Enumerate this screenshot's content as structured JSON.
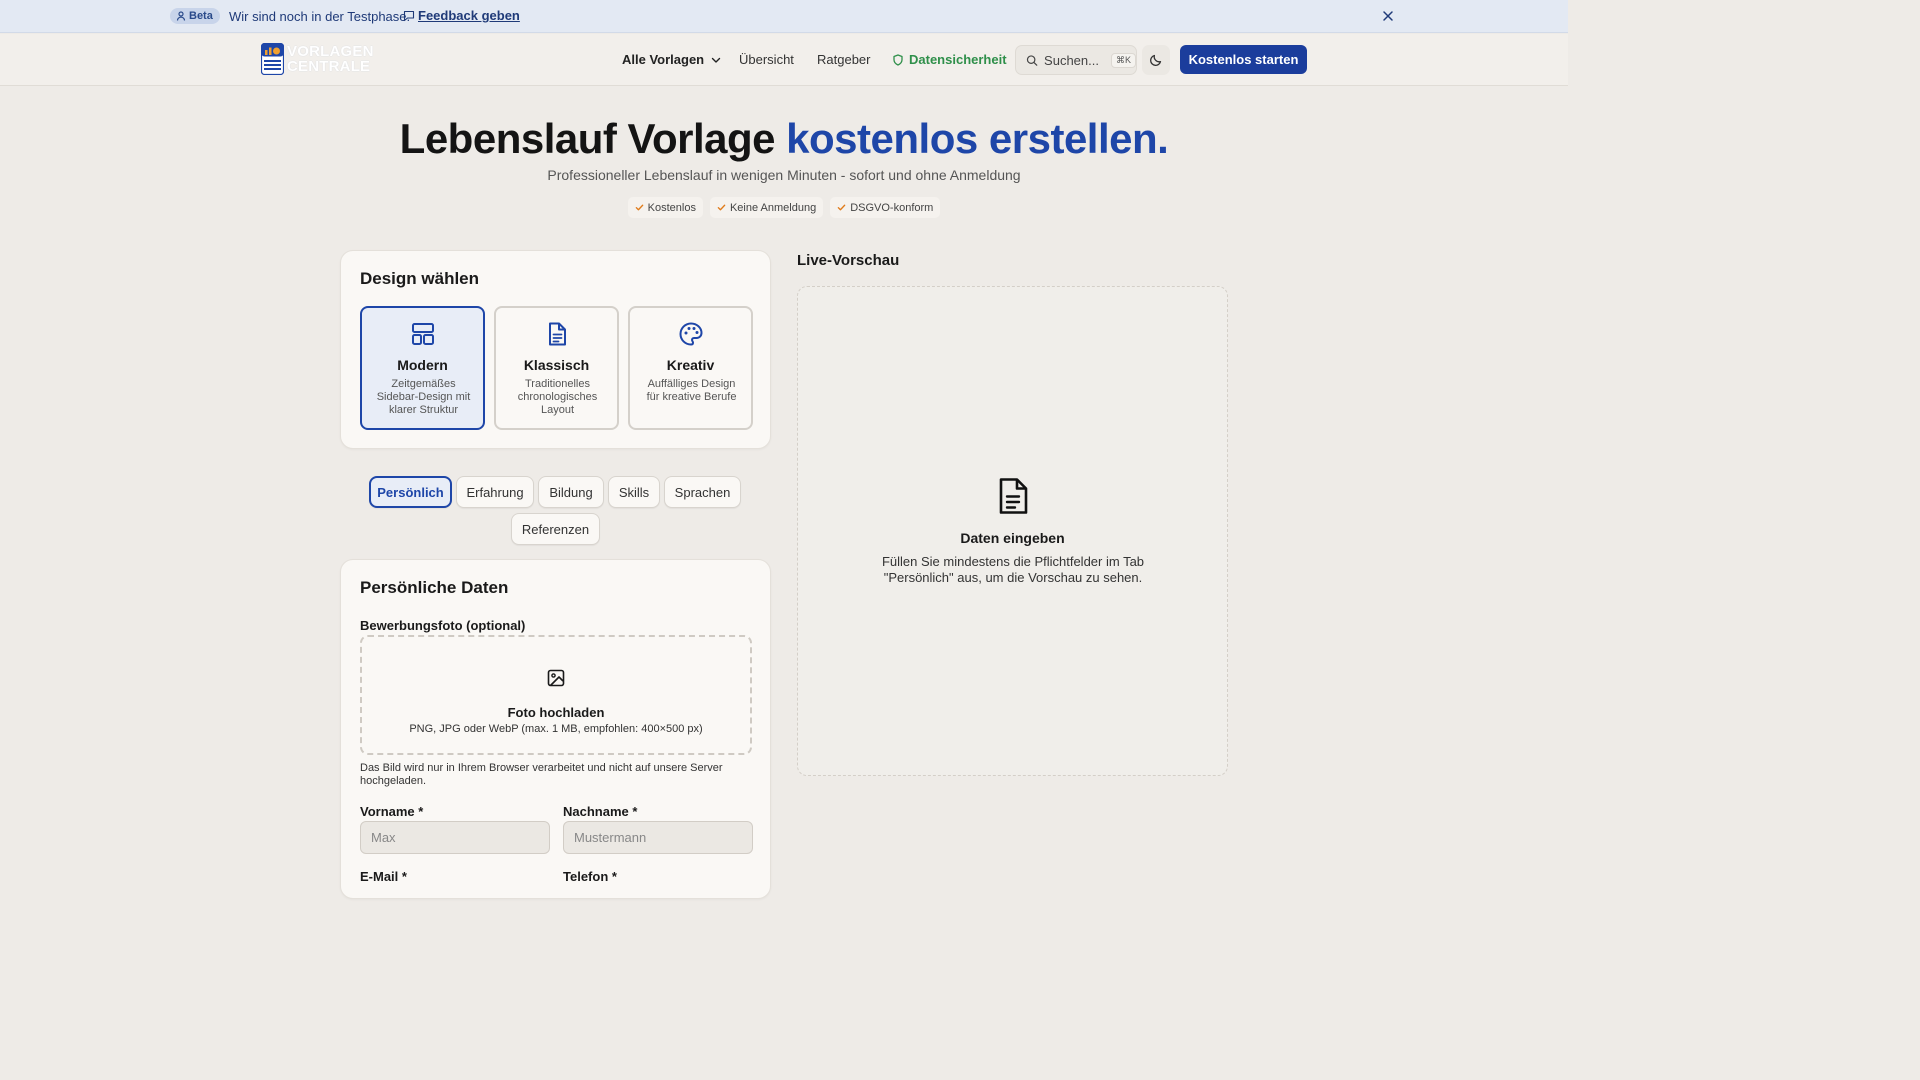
{
  "banner": {
    "badge": "Beta",
    "text": "Wir sind noch in der Testphase.",
    "feedback_link": "Feedback geben"
  },
  "header": {
    "logo_line1": "VORLAGEN",
    "logo_line2": "CENTRALE",
    "nav": {
      "all_templates": "Alle Vorlagen",
      "overview": "Übersicht",
      "guide": "Ratgeber",
      "security": "Datensicherheit"
    },
    "search_placeholder": "Suchen...",
    "search_shortcut": "⌘K",
    "cta": "Kostenlos starten"
  },
  "hero": {
    "title_main": "Lebenslauf Vorlage ",
    "title_accent": "kostenlos erstellen.",
    "subtitle": "Professioneller Lebenslauf in wenigen Minuten - sofort und ohne Anmeldung",
    "chips": [
      "Kostenlos",
      "Keine Anmeldung",
      "DSGVO-konform"
    ]
  },
  "design": {
    "title": "Design wählen",
    "options": [
      {
        "name": "Modern",
        "desc": "Zeitgemäßes Sidebar-Design mit klarer Struktur",
        "icon": "layout-icon",
        "selected": true
      },
      {
        "name": "Klassisch",
        "desc": "Traditionelles chronologisches Layout",
        "icon": "document-icon",
        "selected": false
      },
      {
        "name": "Kreativ",
        "desc": "Auffälliges Design für kreative Berufe",
        "icon": "palette-icon",
        "selected": false
      }
    ]
  },
  "tabs": [
    "Persönlich",
    "Erfahrung",
    "Bildung",
    "Skills",
    "Sprachen",
    "Referenzen"
  ],
  "active_tab": "Persönlich",
  "personal": {
    "title": "Persönliche Daten",
    "photo_label": "Bewerbungsfoto (optional)",
    "upload_title": "Foto hochladen",
    "upload_hint": "PNG, JPG oder WebP (max. 1 MB, empfohlen: 400×500 px)",
    "upload_note": "Das Bild wird nur in Ihrem Browser verarbeitet und nicht auf unsere Server hochgeladen.",
    "firstname_label": "Vorname *",
    "firstname_placeholder": "Max",
    "lastname_label": "Nachname *",
    "lastname_placeholder": "Mustermann",
    "email_label": "E-Mail *",
    "phone_label": "Telefon *"
  },
  "preview": {
    "title": "Live-Vorschau",
    "heading": "Daten eingeben",
    "text": "Füllen Sie mindestens die Pflichtfelder im Tab \"Persönlich\" aus, um die Vorschau zu sehen."
  },
  "colors": {
    "accent": "#1e46a8",
    "cta": "#1b3d9c",
    "security": "#2f8f4a",
    "chip_check": "#e07b1a"
  }
}
